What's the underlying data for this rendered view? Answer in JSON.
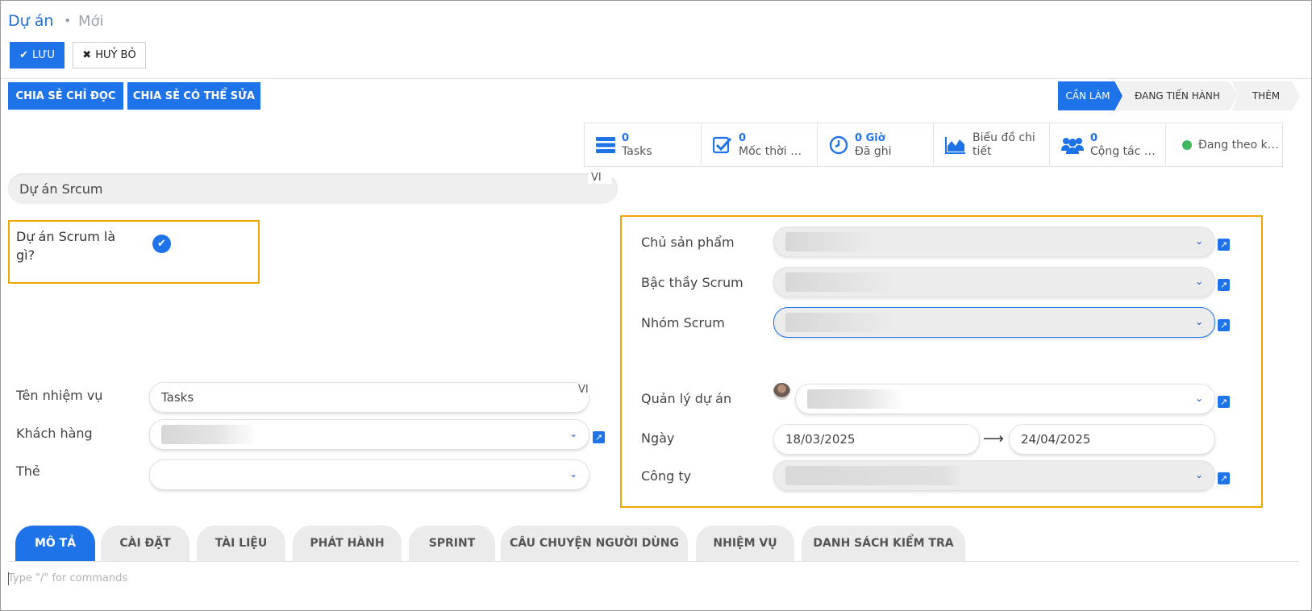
{
  "breadcrumb": {
    "root": "Dự án",
    "separator": "•",
    "current": "Mới"
  },
  "toolbar": {
    "save_label": "LƯU",
    "cancel_label": "HUỶ BỎ"
  },
  "share": {
    "readonly_label": "CHIA SẺ CHỈ ĐỌC",
    "editable_label": "CHIA SẺ CÓ THỂ SỬA"
  },
  "stages": {
    "current": "CẦN LÀM",
    "in_progress": "ĐANG TIẾN HÀNH",
    "more": "THÊM"
  },
  "smart_buttons": {
    "tasks": {
      "value": "0",
      "label": "Tasks",
      "icon": "tasks-icon"
    },
    "milestones": {
      "value": "0",
      "label": "Mốc thời gi...",
      "icon": "checkbox-icon"
    },
    "time": {
      "value": "0 Giờ",
      "label": "Đã ghi",
      "icon": "clock-icon"
    },
    "chart": {
      "label": "Biểu đồ chi tiết",
      "icon": "area-chart-icon"
    },
    "collaborators": {
      "value": "0",
      "label": "Cộng tác vi...",
      "icon": "users-icon"
    },
    "status": {
      "label": "Đang theo kế hoạch",
      "color": "#3fb65f"
    }
  },
  "project": {
    "name": "Dự án Srcum",
    "lang": "VI"
  },
  "scrum_question": {
    "label": "Dự án Scrum là gì?",
    "checked": true
  },
  "left_fields": {
    "task_name": {
      "label": "Tên nhiệm vụ",
      "value": "Tasks",
      "lang": "VI"
    },
    "customer": {
      "label": "Khách hàng"
    },
    "tags": {
      "label": "Thẻ"
    }
  },
  "right_fields": {
    "product_owner": {
      "label": "Chủ sản phẩm"
    },
    "scrum_master": {
      "label": "Bậc thầy Scrum"
    },
    "scrum_team": {
      "label": "Nhóm Scrum"
    },
    "project_manager": {
      "label": "Quản lý dự án"
    },
    "dates": {
      "label": "Ngày",
      "start": "18/03/2025",
      "end": "24/04/2025"
    },
    "company": {
      "label": "Công ty"
    }
  },
  "tabs": [
    "MÔ TẢ",
    "CÀI ĐẶT",
    "TÀI LIỆU",
    "PHÁT HÀNH",
    "SPRINT",
    "CÂU CHUYỆN NGƯỜI DÙNG",
    "NHIỆM VỤ",
    "DANH SÁCH KIỂM TRA"
  ],
  "editor": {
    "placeholder": "Type \"/\" for commands"
  },
  "colors": {
    "accent": "#1f73e8",
    "highlight_border": "#f0a500"
  }
}
